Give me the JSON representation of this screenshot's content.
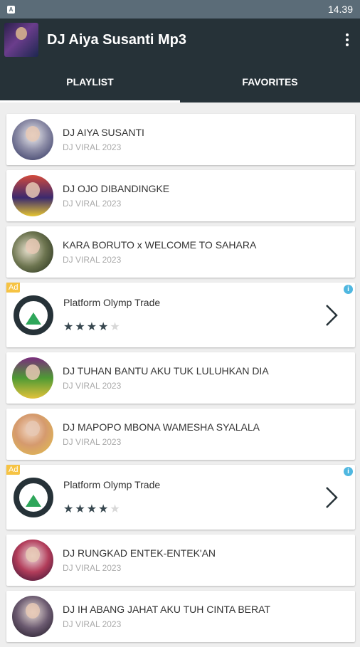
{
  "status": {
    "time": "14.39",
    "notif_icon": "A"
  },
  "app": {
    "title": "DJ Aiya Susanti Mp3"
  },
  "tabs": [
    {
      "label": "PLAYLIST"
    },
    {
      "label": "FAVORITES"
    }
  ],
  "songs": [
    {
      "title": "DJ AIYA SUSANTI",
      "subtitle": "DJ VIRAL 2023"
    },
    {
      "title": "DJ OJO DIBANDINGKE",
      "subtitle": "DJ VIRAL 2023"
    },
    {
      "title": "KARA BORUTO x WELCOME TO SAHARA",
      "subtitle": "DJ VIRAL 2023"
    },
    {
      "title": "DJ TUHAN BANTU AKU TUK LULUHKAN DIA",
      "subtitle": "DJ VIRAL 2023"
    },
    {
      "title": "DJ MAPOPO MBONA WAMESHA SYALALA",
      "subtitle": "DJ VIRAL 2023"
    },
    {
      "title": "DJ RUNGKAD ENTEK-ENTEK'AN",
      "subtitle": "DJ VIRAL 2023"
    },
    {
      "title": "DJ IH ABANG JAHAT AKU TUH CINTA BERAT",
      "subtitle": "DJ VIRAL 2023"
    }
  ],
  "ads": [
    {
      "badge": "Ad",
      "name": "Platform Olymp Trade",
      "rating_stars": 4,
      "max_stars": 5,
      "info": "i"
    },
    {
      "badge": "Ad",
      "name": "Platform Olymp Trade",
      "rating_stars": 4,
      "max_stars": 5,
      "info": "i"
    }
  ],
  "colors": {
    "appbar": "#263238",
    "statusbar": "#5b6c78",
    "ad_badge": "#f6c343",
    "ad_logo": "#263238",
    "ad_logo_accent": "#2ea65a"
  }
}
